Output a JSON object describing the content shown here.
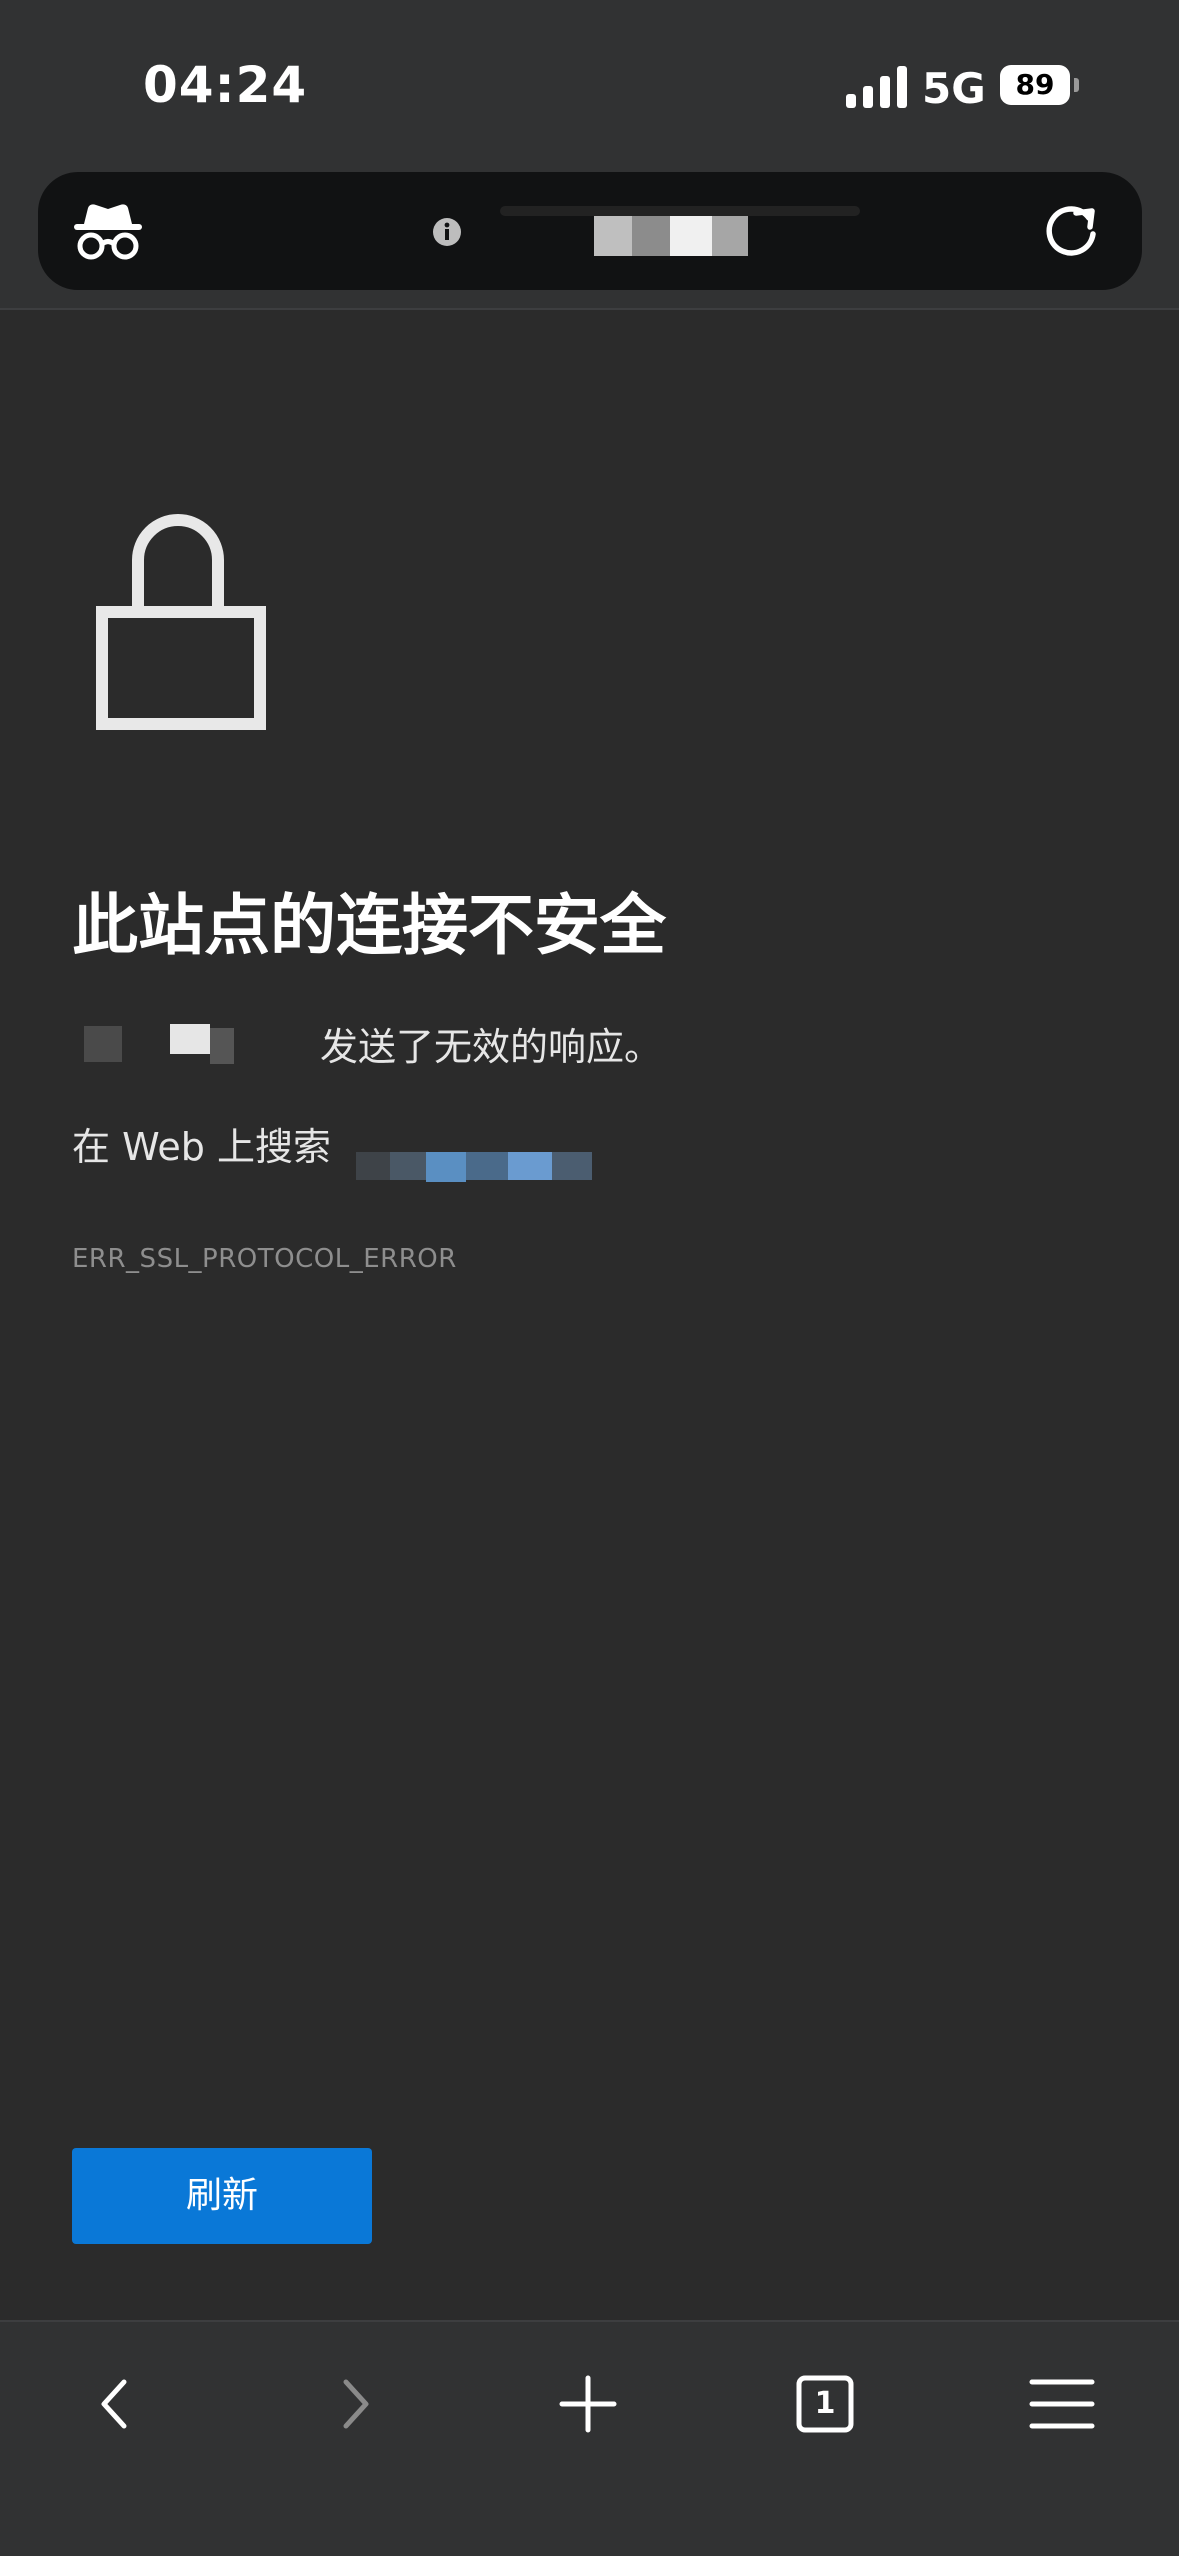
{
  "status_bar": {
    "time": "04:24",
    "network": "5G",
    "battery": "89"
  },
  "address_bar": {
    "mode_icon": "incognito-icon",
    "site_info_icon": "info-icon",
    "reload_icon": "reload-icon"
  },
  "error_page": {
    "icon": "unlocked-padlock-icon",
    "title": "此站点的连接不安全",
    "response_text": "发送了无效的响应。",
    "search_prefix": "在 Web 上搜索",
    "error_code": "ERR_SSL_PROTOCOL_ERROR",
    "reload_button": "刷新"
  },
  "toolbar": {
    "back_icon": "chevron-left-icon",
    "forward_icon": "chevron-right-icon",
    "new_tab_icon": "plus-icon",
    "tab_count": "1",
    "menu_icon": "hamburger-icon"
  },
  "colors": {
    "page_background": "#2b2b2b",
    "chrome_background": "#313233",
    "address_bar_background": "#111213",
    "primary_button": "#0a78d7",
    "error_code_text": "#8e8e8e"
  }
}
